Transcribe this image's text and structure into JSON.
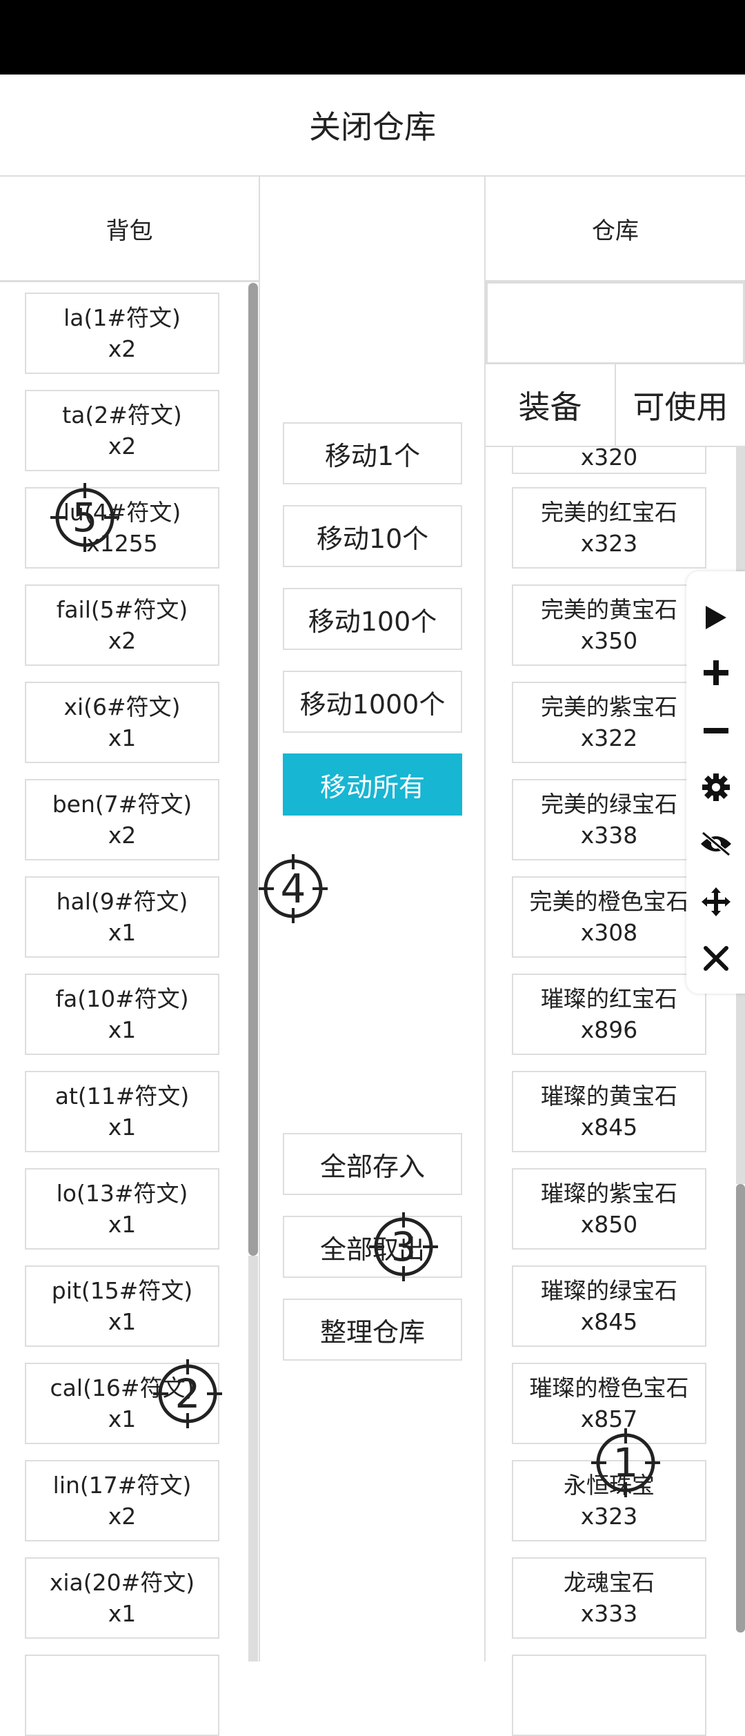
{
  "header": {
    "title": "关闭仓库"
  },
  "bag": {
    "title": "背包",
    "items": [
      {
        "name": "la(1#符文)",
        "count": "x2"
      },
      {
        "name": "ta(2#符文)",
        "count": "x2"
      },
      {
        "name": "lu(4#符文)",
        "count": "x1255"
      },
      {
        "name": "fail(5#符文)",
        "count": "x2"
      },
      {
        "name": "xi(6#符文)",
        "count": "x1"
      },
      {
        "name": "ben(7#符文)",
        "count": "x2"
      },
      {
        "name": "hal(9#符文)",
        "count": "x1"
      },
      {
        "name": "fa(10#符文)",
        "count": "x1"
      },
      {
        "name": "at(11#符文)",
        "count": "x1"
      },
      {
        "name": "lo(13#符文)",
        "count": "x1"
      },
      {
        "name": "pit(15#符文)",
        "count": "x1"
      },
      {
        "name": "cal(16#符文)",
        "count": "x1"
      },
      {
        "name": "lin(17#符文)",
        "count": "x2"
      },
      {
        "name": "xia(20#符文)",
        "count": "x1"
      }
    ]
  },
  "middle": {
    "move_1": "移动1个",
    "move_10": "移动10个",
    "move_100": "移动100个",
    "move_1000": "移动1000个",
    "move_all": "移动所有",
    "deposit_all": "全部存入",
    "withdraw_all": "全部取出",
    "sort_warehouse": "整理仓库"
  },
  "warehouse": {
    "title": "仓库",
    "tabs": [
      "装备",
      "可使用"
    ],
    "partial_top_count": "x320",
    "items": [
      {
        "name": "完美的红宝石",
        "count": "x323"
      },
      {
        "name": "完美的黄宝石",
        "count": "x350"
      },
      {
        "name": "完美的紫宝石",
        "count": "x322"
      },
      {
        "name": "完美的绿宝石",
        "count": "x338"
      },
      {
        "name": "完美的橙色宝石",
        "count": "x308"
      },
      {
        "name": "璀璨的红宝石",
        "count": "x896"
      },
      {
        "name": "璀璨的黄宝石",
        "count": "x845"
      },
      {
        "name": "璀璨的紫宝石",
        "count": "x850"
      },
      {
        "name": "璀璨的绿宝石",
        "count": "x845"
      },
      {
        "name": "璀璨的橙色宝石",
        "count": "x857"
      },
      {
        "name": "永恒珠宝",
        "count": "x323"
      },
      {
        "name": "龙魂宝石",
        "count": "x333"
      }
    ]
  },
  "toolbar": {
    "icons": [
      "play-icon",
      "plus-icon",
      "minus-icon",
      "gear-icon",
      "eye-slash-icon",
      "move-icon",
      "close-icon"
    ]
  },
  "markers": [
    "1",
    "2",
    "3",
    "4",
    "5"
  ]
}
